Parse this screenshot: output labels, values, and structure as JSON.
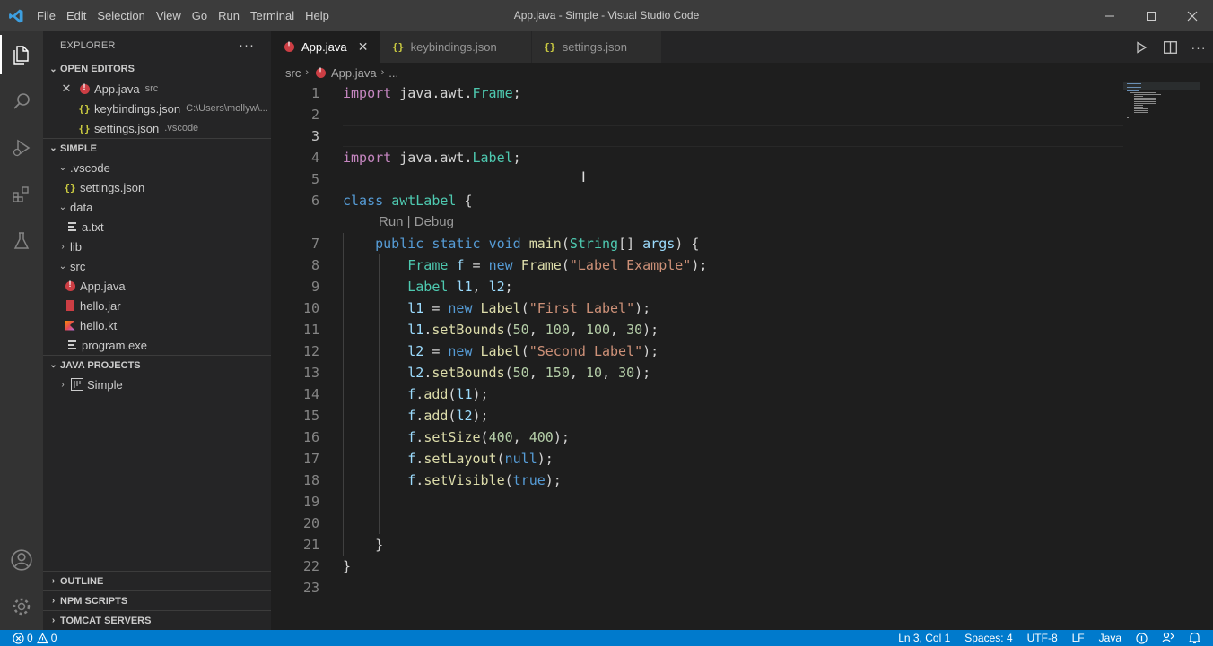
{
  "window": {
    "title": "App.java - Simple - Visual Studio Code",
    "menu": [
      "File",
      "Edit",
      "Selection",
      "View",
      "Go",
      "Run",
      "Terminal",
      "Help"
    ]
  },
  "sidebar": {
    "title": "EXPLORER",
    "open_editors": {
      "label": "OPEN EDITORS",
      "items": [
        {
          "name": "App.java",
          "desc": "src",
          "icon": "java-icon"
        },
        {
          "name": "keybindings.json",
          "desc": "C:\\Users\\mollyw\\...",
          "icon": "json-icon"
        },
        {
          "name": "settings.json",
          "desc": ".vscode",
          "icon": "json-icon"
        }
      ]
    },
    "workspace": {
      "label": "SIMPLE",
      "tree": [
        {
          "name": ".vscode",
          "type": "folder-open"
        },
        {
          "name": "settings.json",
          "type": "json"
        },
        {
          "name": "data",
          "type": "folder-open"
        },
        {
          "name": "a.txt",
          "type": "txt"
        },
        {
          "name": "lib",
          "type": "folder-closed"
        },
        {
          "name": "src",
          "type": "folder-open"
        },
        {
          "name": "App.java",
          "type": "java"
        },
        {
          "name": "hello.jar",
          "type": "jar"
        },
        {
          "name": "hello.kt",
          "type": "kotlin"
        },
        {
          "name": "program.exe",
          "type": "txt"
        }
      ]
    },
    "java_projects": {
      "label": "JAVA PROJECTS",
      "items": [
        {
          "name": "Simple"
        }
      ]
    },
    "bottom_sections": [
      "OUTLINE",
      "NPM SCRIPTS",
      "TOMCAT SERVERS"
    ]
  },
  "tabs": [
    {
      "label": "App.java",
      "active": true
    },
    {
      "label": "keybindings.json",
      "active": false
    },
    {
      "label": "settings.json",
      "active": false
    }
  ],
  "breadcrumb": [
    "src",
    "App.java",
    "..."
  ],
  "editor": {
    "line_numbers": [
      "1",
      "2",
      "3",
      "4",
      "5",
      "6",
      "7",
      "8",
      "9",
      "10",
      "11",
      "12",
      "13",
      "14",
      "15",
      "16",
      "17",
      "18",
      "19",
      "20",
      "21",
      "22",
      "23"
    ],
    "current_line": "3",
    "code_lens": "Run | Debug"
  },
  "status": {
    "errors": "0",
    "warnings": "0",
    "position": "Ln 3, Col 1",
    "spaces": "Spaces: 4",
    "encoding": "UTF-8",
    "eol": "LF",
    "language": "Java"
  },
  "colors": {
    "accent": "#007acc",
    "keyword": "#569cd6",
    "type": "#4ec9b0",
    "string": "#ce9178",
    "number": "#b5cea8"
  }
}
